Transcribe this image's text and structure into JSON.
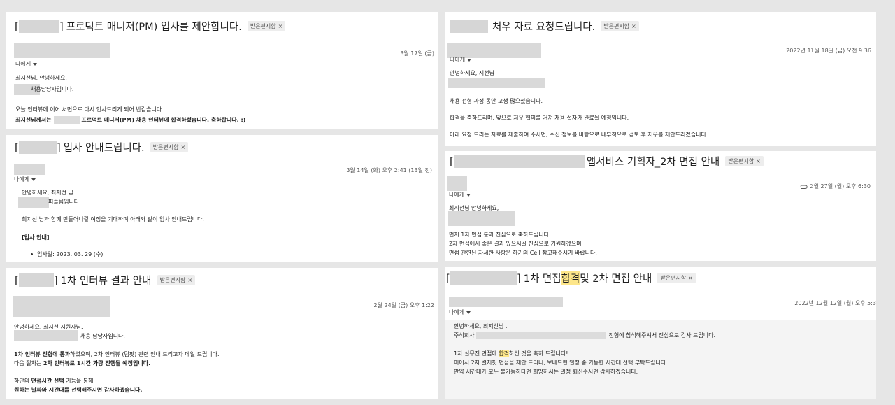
{
  "common": {
    "inbox_tag": "받은편지함",
    "remove_tag": "×",
    "to_me": "나에게"
  },
  "email1": {
    "subject_open": "[",
    "subject_close": "]",
    "subject_text": "프로덕트 매니저(PM) 입사를 제안합니다.",
    "date": "3월 17일 (금)",
    "body1": "최지선님, 안녕하세요.",
    "body2": "채용담당자입니다.",
    "body3": "오늘 인터뷰에 이어 서면으로 다시 인사드리게 되어 반갑습니다.",
    "body4_a": "최지선님께서는",
    "body4_b": "프로덕트 매니저(PM) 채용 인터뷰에 합격하셨습니다. 축하합니다. :)"
  },
  "email2": {
    "subject_open": "[",
    "subject_close": "]",
    "subject_text": "입사 안내드립니다.",
    "date": "3월 14일 (화) 오후 2:41 (13일 전)",
    "body1": "안녕하세요, 최지선 님",
    "body2": "피플팀입니다.",
    "body3": "최지선 님과 함께 만들어나갈 여정을 기대하며 아래와 같이 입사 안내드립니다.",
    "body4": "[입사 안내]",
    "body5": "입사일: 2023. 03. 29 (수)"
  },
  "email3": {
    "subject_open": "[",
    "subject_close": "]",
    "subject_text": "1차 인터뷰 결과 안내",
    "date": "2월 24일 (금) 오후 1:22",
    "body1": "안녕하세요, 최지선 지원자님.",
    "body2": "채용 담당자입니다.",
    "body3_a": "1차 인터뷰 전형에 통과",
    "body3_b": "하셨으며, 2차 인터뷰 (팀핏) 관련 안내 드리고자 메일 드립니다.",
    "body4_a": "다음 절차는 ",
    "body4_b": "2차 인터뷰로 1시간 가량 진행될 예정입니다.",
    "body5_a": "하단의 ",
    "body5_b": "면접시간 선택",
    "body5_c": " 기능을 통해",
    "body6": "원하는 날짜와 시간대를 선택해주시면 감사하겠습니다."
  },
  "email4": {
    "subject_text": "처우 자료 요청드립니다.",
    "date": "2022년 11월 18일 (금) 오전 9:36",
    "body1": "안녕하세요, 지선님",
    "body2": "채용 전형 과정 동안 고생 많으셨습니다.",
    "body3": "합격을 축하드리며, 앞으로 처우 협의를 거쳐 채용 절차가 완료될 예정입니다.",
    "body4": "아래 요청 드리는 자료를 제출하여 주시면, 주신 정보를 바탕으로 내부적으로 검토 후 처우를 제안드리겠습니다."
  },
  "email5": {
    "subject_open": "[",
    "subject_text": "앱서비스 기획자_2차 면접 안내",
    "date": "2월 27일 (월) 오후 6:30",
    "body1": "최지선님 안녕하세요,",
    "body2": "먼저 1차 면접 통과 진심으로 축하드립니다.",
    "body3": "2차 면접에서 좋은 결과 있으시길 진심으로 기원하겠으며",
    "body4": "면접 관련된 자세한 사항은 하기의 Cell 참고해주시기 바랍니다."
  },
  "email6": {
    "subject_open": "[",
    "subject_close": "]",
    "subject_a": "1차 면접 ",
    "subject_hl": "합격",
    "subject_b": " 및 2차 면접 안내",
    "date": "2022년 12월 12일 (월) 오후 5:3",
    "body1": "안녕하세요, 최지선님 .",
    "body2_a": "주식회사",
    "body2_b": "전형에 참석해주셔서 진심으로 감사 드립니다.",
    "body3_a": "1차 실무진 면접에 ",
    "body3_hl": "합격",
    "body3_b": "하신 것을 축하 드립니다!",
    "body4": "이어서 2차 컬처핏 면접을 제안 드리니, 보내드린 일정 중 가능한 시간대 선택 부탁드립니다.",
    "body5": "만약 시간대가 모두 불가능하다면 희망하시는 일정 회신주시면 감사하겠습니다."
  }
}
